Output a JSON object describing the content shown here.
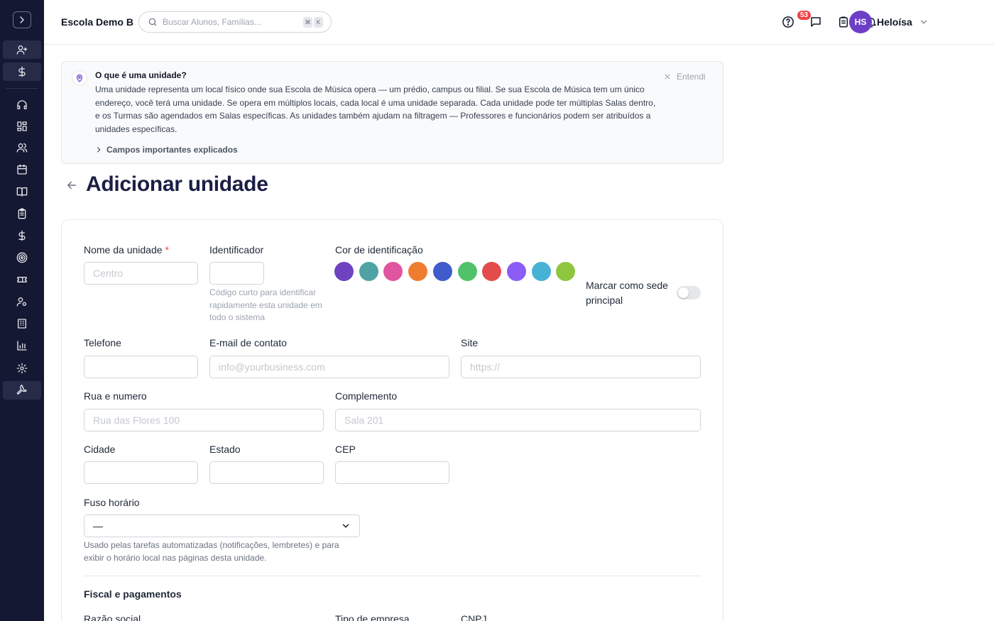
{
  "sidebar": {
    "toggle_icon": "chevron-right-icon",
    "items": [
      {
        "name": "add-user-icon"
      },
      {
        "name": "dollar-icon"
      },
      {
        "name": "headset-icon"
      },
      {
        "name": "dashboard-icon"
      },
      {
        "name": "users-icon"
      },
      {
        "name": "calendar-icon"
      },
      {
        "name": "book-icon"
      },
      {
        "name": "clipboard-icon"
      },
      {
        "name": "dollar-icon"
      },
      {
        "name": "target-icon"
      },
      {
        "name": "ticket-icon"
      },
      {
        "name": "user-settings-icon"
      },
      {
        "name": "building-icon"
      },
      {
        "name": "chart-icon"
      },
      {
        "name": "gear-icon"
      },
      {
        "name": "wrench-icon"
      }
    ]
  },
  "topbar": {
    "school_name": "Escola Demo B",
    "search_placeholder": "Buscar Alunos, Famílias...",
    "shortcut_keys": [
      "⌘",
      "K"
    ],
    "tasks_badge": "53",
    "avatar_initials": "HS",
    "user_name": "Heloísa"
  },
  "info": {
    "title": "O que é uma unidade?",
    "body": "Uma unidade representa um local físico onde sua Escola de Música opera — um prédio, campus ou filial. Se sua Escola de Música tem um único endereço, você terá uma unidade. Se opera em múltiplos locais, cada local é uma unidade separada. Cada unidade pode ter múltiplas Salas dentro, e os Turmas são agendados em Salas específicas. As unidades também ajudam na filtragem — Professores e funcionários podem ser atribuídos a unidades específicas.",
    "dismiss_label": "Entendi",
    "expand_label": "Campos importantes explicados"
  },
  "page": {
    "title": "Adicionar unidade"
  },
  "form": {
    "name_label": "Nome da unidade",
    "name_required_mark": "*",
    "name_placeholder": "Centro",
    "identifier_label": "Identificador",
    "identifier_hint": "Código curto para identificar rapidamente esta unidade em todo o sistema",
    "color_label": "Cor de identificação",
    "colors": [
      "#6f42c1",
      "#4fa3a5",
      "#e0559f",
      "#ee7d31",
      "#3f5bcc",
      "#51c26a",
      "#e24c4b",
      "#8b5cf6",
      "#48b1d6",
      "#8ec63f"
    ],
    "headquarters_label": "Marcar como sede principal",
    "headquarters_on": false,
    "phone_label": "Telefone",
    "email_label": "E-mail de contato",
    "email_placeholder": "info@yourbusiness.com",
    "website_label": "Site",
    "website_placeholder": "https://",
    "street_label": "Rua e numero",
    "street_placeholder": "Rua das Flores 100",
    "complement_label": "Complemento",
    "complement_placeholder": "Sala 201",
    "city_label": "Cidade",
    "state_label": "Estado",
    "zip_label": "CEP",
    "timezone_label": "Fuso horário",
    "timezone_value": "—",
    "timezone_hint": "Usado pelas tarefas automatizadas (notificações, lembretes) e para exibir o horário local nas páginas desta unidade.",
    "fiscal_section_title": "Fiscal e pagamentos",
    "legal_name_label": "Razão social",
    "company_type_label": "Tipo de empresa",
    "cnpj_label": "CNPJ"
  }
}
